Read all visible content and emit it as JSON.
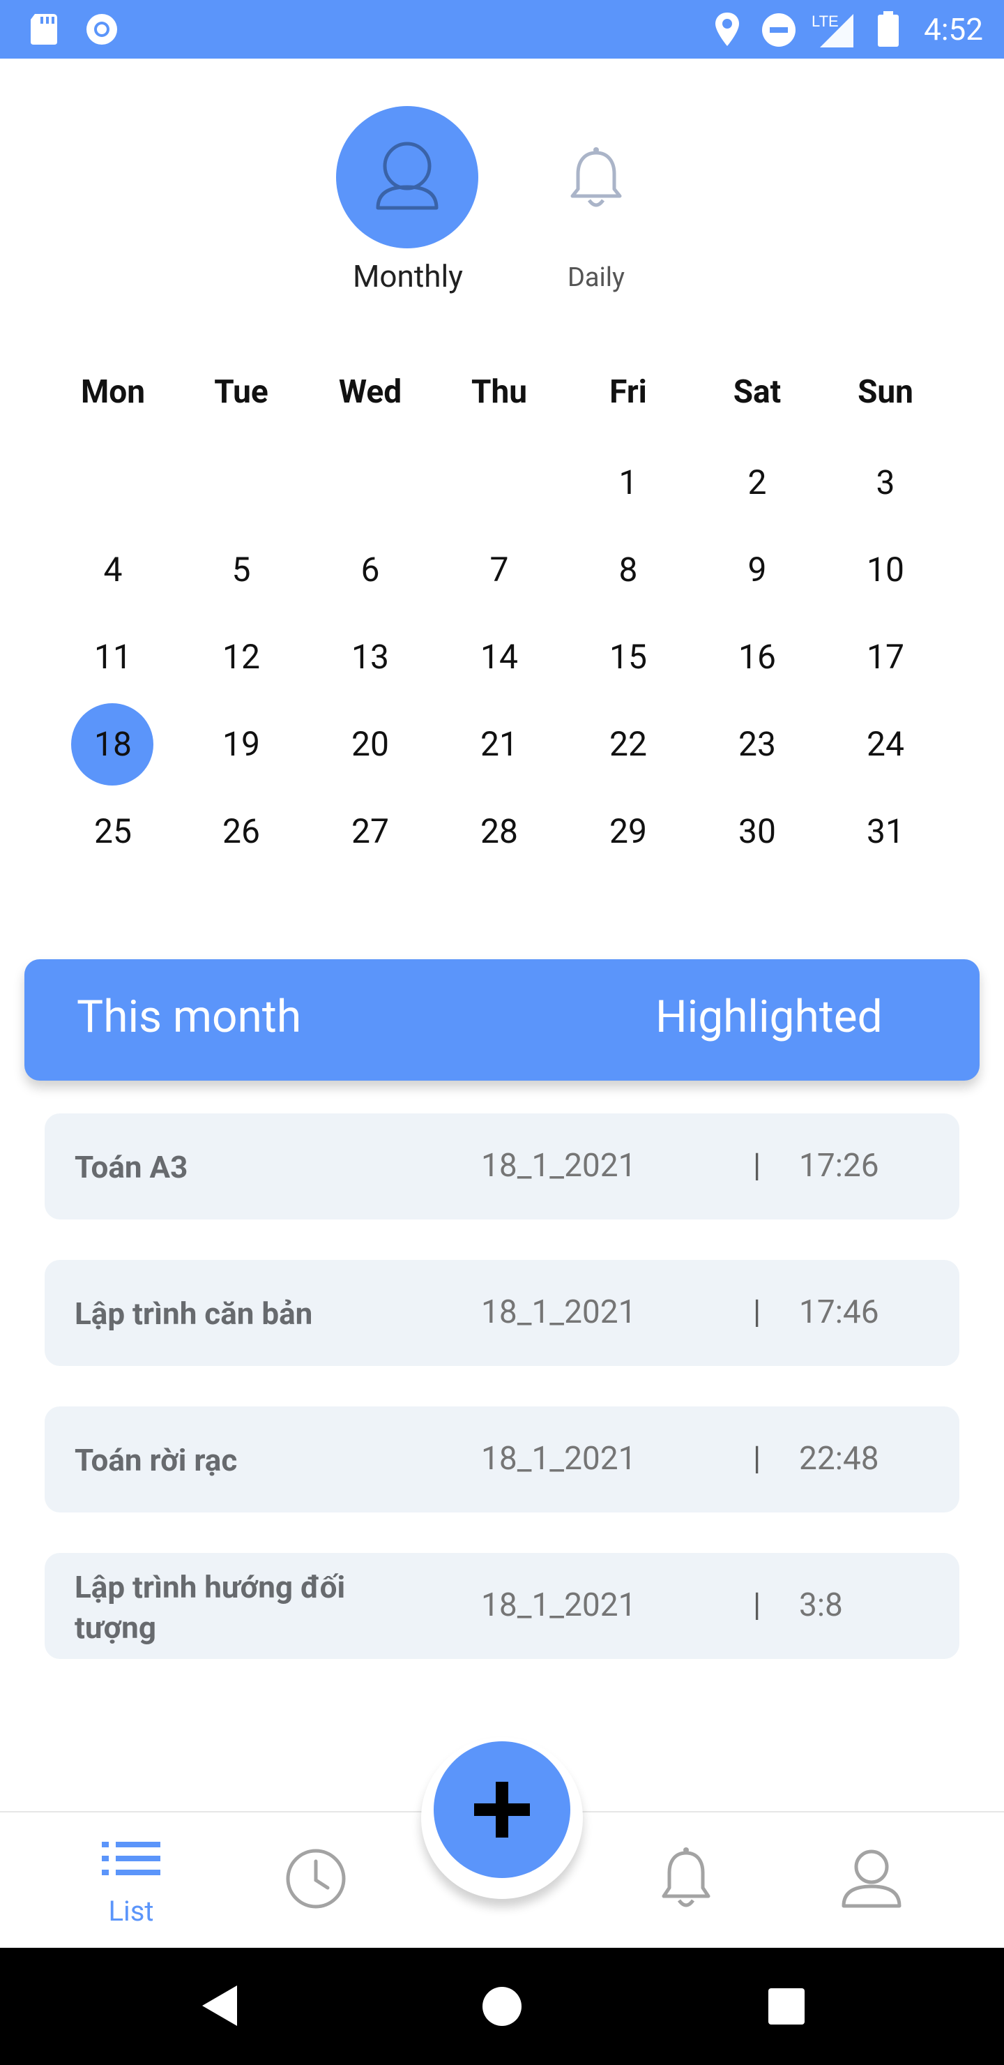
{
  "status_bar": {
    "time": "4:52",
    "network": "LTE"
  },
  "mode_toggle": {
    "monthly_label": "Monthly",
    "daily_label": "Daily"
  },
  "calendar": {
    "weekdays": [
      "Mon",
      "Tue",
      "Wed",
      "Thu",
      "Fri",
      "Sat",
      "Sun"
    ],
    "weeks": [
      [
        "",
        "",
        "",
        "",
        "1",
        "2",
        "3"
      ],
      [
        "4",
        "5",
        "6",
        "7",
        "8",
        "9",
        "10"
      ],
      [
        "11",
        "12",
        "13",
        "14",
        "15",
        "16",
        "17"
      ],
      [
        "18",
        "19",
        "20",
        "21",
        "22",
        "23",
        "24"
      ],
      [
        "25",
        "26",
        "27",
        "28",
        "29",
        "30",
        "31"
      ]
    ],
    "selected_day": "18"
  },
  "segment": {
    "this_month": "This month",
    "highlighted": "Highlighted"
  },
  "notes": [
    {
      "title": "Toán A3",
      "date": "18_1_2021",
      "sep": "|",
      "time": "17:26"
    },
    {
      "title": "Lập trình căn bản",
      "date": "18_1_2021",
      "sep": "|",
      "time": "17:46"
    },
    {
      "title": "Toán rời rạc",
      "date": "18_1_2021",
      "sep": "|",
      "time": "22:48"
    },
    {
      "title": "Lập trình hướng đối tượng",
      "date": "18_1_2021",
      "sep": "|",
      "time": "3:8"
    }
  ],
  "bottom_nav": {
    "list_label": "List"
  },
  "colors": {
    "accent": "#5b95fa",
    "row_bg": "#eef3f8",
    "icon_gray": "#9e9e9e"
  }
}
